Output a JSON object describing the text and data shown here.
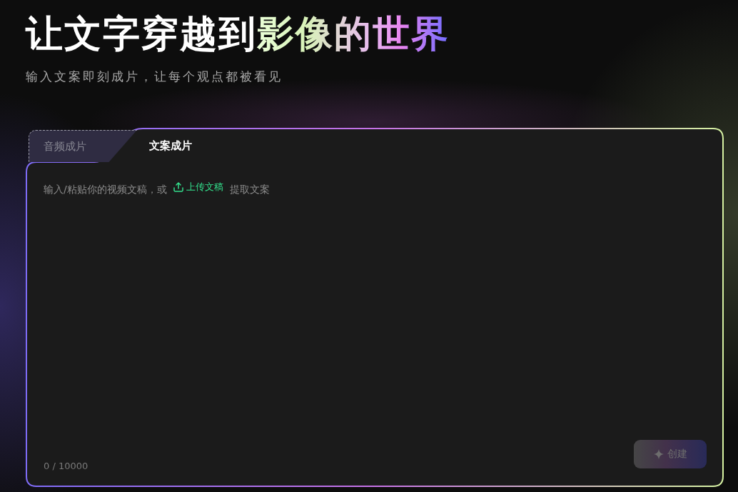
{
  "title": {
    "text": "让文字穿越到",
    "highlight": "影像的世界"
  },
  "subtitle": "输入文案即刻成片，让每个观点都被看见",
  "tabs": [
    {
      "label": "音频成片",
      "selected": false
    },
    {
      "label": "文案成片",
      "selected": true
    }
  ],
  "editor": {
    "placeholder_before": "输入/粘贴你的视频文稿，或",
    "upload_link": "上传文稿",
    "placeholder_after": "提取文案",
    "counter": "0 / 10000"
  },
  "create_button": {
    "label": "创建",
    "disabled": true
  }
}
